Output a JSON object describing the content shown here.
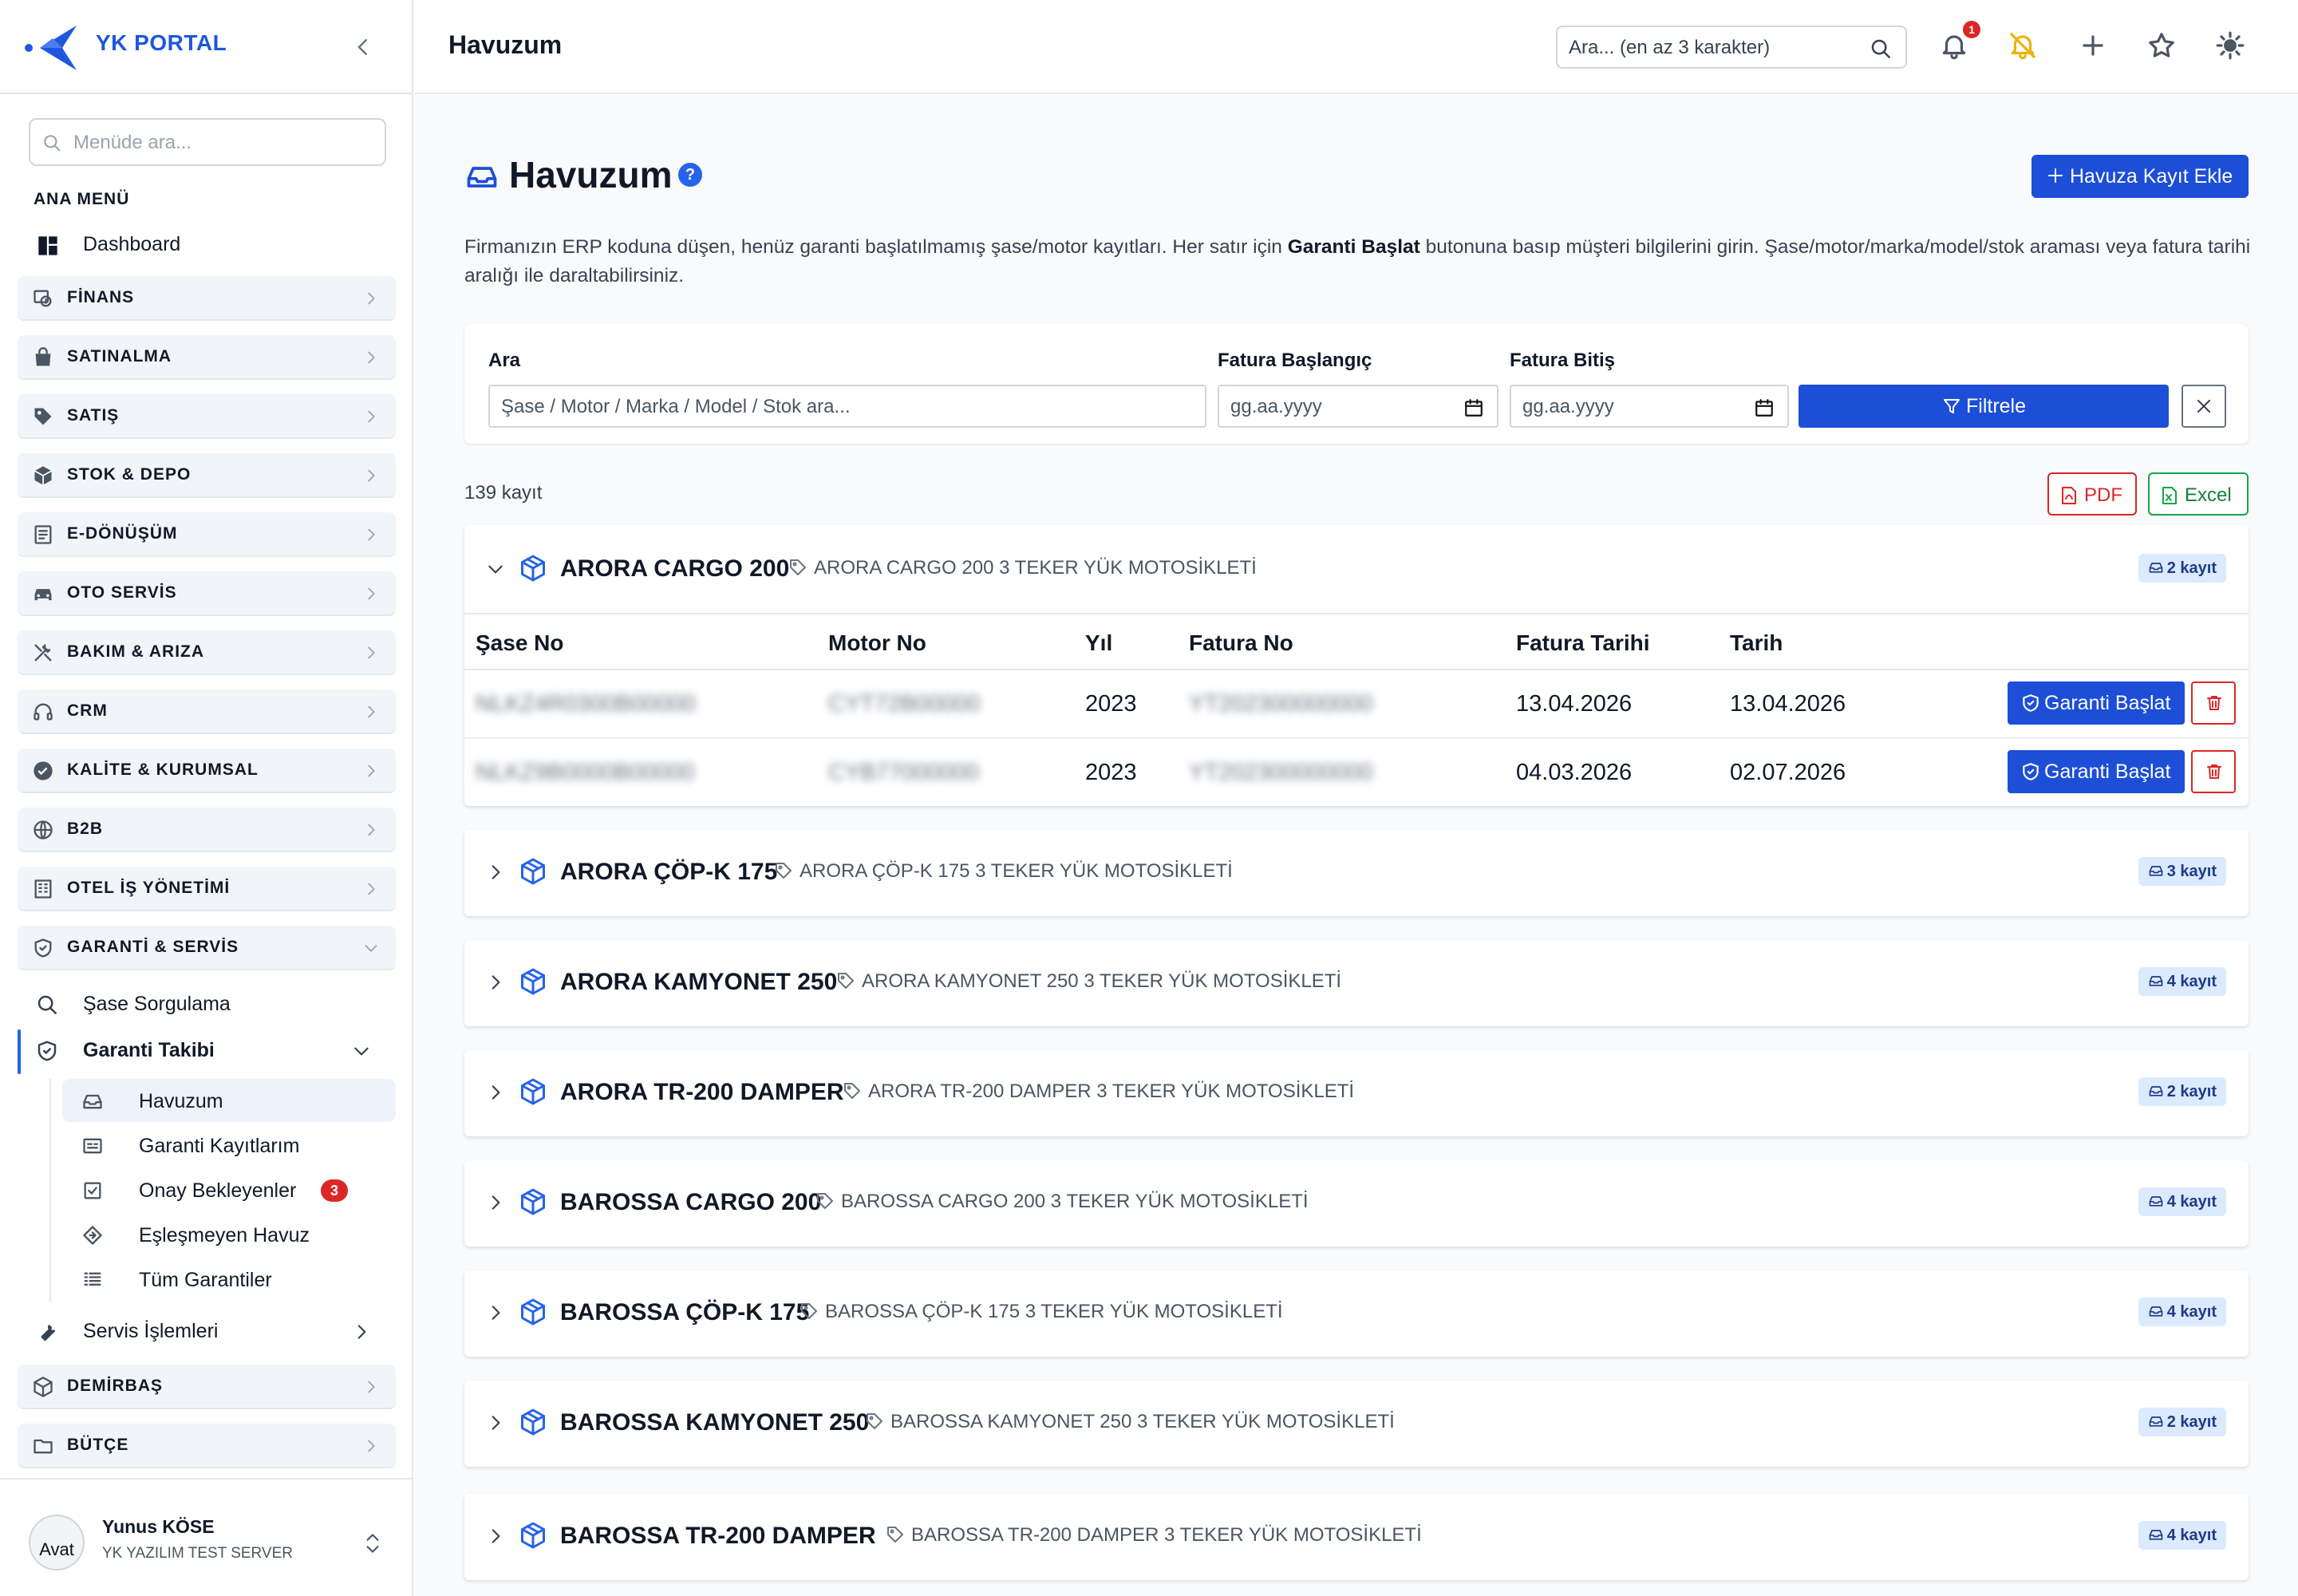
{
  "brand": {
    "name": "YK PORTAL"
  },
  "sidebar": {
    "search_placeholder": "Menüde ara...",
    "section_title": "ANA MENÜ",
    "dashboard": "Dashboard",
    "groups_top": [
      {
        "label": "FİNANS",
        "icon": "finance-icon"
      },
      {
        "label": "SATINALMA",
        "icon": "bag-icon"
      },
      {
        "label": "SATIŞ",
        "icon": "tag-icon"
      },
      {
        "label": "STOK & DEPO",
        "icon": "box-icon"
      },
      {
        "label": "E-DÖNÜŞÜM",
        "icon": "document-icon"
      },
      {
        "label": "OTO SERVİS",
        "icon": "car-icon"
      },
      {
        "label": "BAKIM & ARIZA",
        "icon": "tools-icon"
      },
      {
        "label": "CRM",
        "icon": "headset-icon"
      },
      {
        "label": "KALİTE & KURUMSAL",
        "icon": "badge-check-icon"
      },
      {
        "label": "B2B",
        "icon": "globe-icon"
      },
      {
        "label": "OTEL İŞ YÖNETİMİ",
        "icon": "building-icon"
      },
      {
        "label": "GARANTİ & SERVİS",
        "icon": "shield-icon"
      }
    ],
    "sase_sorgulama": "Şase Sorgulama",
    "garanti_takibi": "Garanti Takibi",
    "garanti_sub": [
      {
        "label": "Havuzum",
        "icon": "inbox-icon"
      },
      {
        "label": "Garanti Kayıtlarım",
        "icon": "card-icon"
      },
      {
        "label": "Onay Bekleyenler",
        "icon": "check-square-icon",
        "badge": "3"
      },
      {
        "label": "Eşleşmeyen Havuz",
        "icon": "diamond-icon"
      },
      {
        "label": "Tüm Garantiler",
        "icon": "list-icon"
      }
    ],
    "servis_islemleri": "Servis İşlemleri",
    "groups_bottom": [
      {
        "label": "DEMİRBAŞ",
        "icon": "cube-icon"
      },
      {
        "label": "BÜTÇE",
        "icon": "folder-icon"
      }
    ],
    "user": {
      "avatar_text": "Avat",
      "name": "Yunus KÖSE",
      "company": "YK YAZILIM TEST SERVER"
    }
  },
  "topbar": {
    "title": "Havuzum",
    "search_placeholder": "Ara... (en az 3 karakter)",
    "notification_count": "1"
  },
  "main": {
    "title": "Havuzum",
    "help": "?",
    "add_button": "Havuza Kayıt Ekle",
    "description_1": "Firmanızın ERP koduna düşen, henüz garanti başlatılmamış şase/motor kayıtları. Her satır için ",
    "description_bold": "Garanti Başlat",
    "description_2": " butonuna basıp müşteri bilgilerini girin. Şase/motor/marka/model/stok araması veya fatura tarihi aralığı ile daraltabilirsiniz.",
    "filters": {
      "search_label": "Ara",
      "search_placeholder": "Şase / Motor / Marka / Model / Stok ara...",
      "start_label": "Fatura Başlangıç",
      "end_label": "Fatura Bitiş",
      "date_placeholder": "gg.aa.yyyy",
      "filter_button": "Filtrele"
    },
    "record_count": "139 kayıt",
    "pdf_button": "PDF",
    "excel_button": "Excel",
    "table_headers": [
      "Şase No",
      "Motor No",
      "Yıl",
      "Fatura No",
      "Fatura Tarihi",
      "Tarih"
    ],
    "start_warranty": "Garanti Başlat",
    "groups": [
      {
        "name": "ARORA CARGO 200",
        "desc": "ARORA CARGO 200 3 TEKER YÜK MOTOSİKLETİ",
        "count": "2 kayıt",
        "expanded": true,
        "rows": [
          {
            "sase": "NLKZ4R0300B00000",
            "motor": "CYT72B00000",
            "yil": "2023",
            "fatura_no": "YT202300000000",
            "fatura_tarihi": "13.04.2026",
            "tarih": "13.04.2026"
          },
          {
            "sase": "NLKZ9B0000B00000",
            "motor": "CYB77000000",
            "yil": "2023",
            "fatura_no": "YT202300000000",
            "fatura_tarihi": "04.03.2026",
            "tarih": "02.07.2026"
          }
        ]
      },
      {
        "name": "ARORA ÇÖP-K 175",
        "desc": "ARORA ÇÖP-K 175 3 TEKER YÜK MOTOSİKLETİ",
        "count": "3 kayıt"
      },
      {
        "name": "ARORA KAMYONET 250",
        "desc": "ARORA KAMYONET 250 3 TEKER YÜK MOTOSİKLETİ",
        "count": "4 kayıt"
      },
      {
        "name": "ARORA TR-200 DAMPER",
        "desc": "ARORA TR-200 DAMPER 3 TEKER YÜK MOTOSİKLETİ",
        "count": "2 kayıt"
      },
      {
        "name": "BAROSSA CARGO 200",
        "desc": "BAROSSA CARGO 200 3 TEKER YÜK MOTOSİKLETİ",
        "count": "4 kayıt"
      },
      {
        "name": "BAROSSA ÇÖP-K 175",
        "desc": "BAROSSA ÇÖP-K 175 3 TEKER YÜK MOTOSİKLETİ",
        "count": "4 kayıt"
      },
      {
        "name": "BAROSSA KAMYONET 250",
        "desc": "BAROSSA KAMYONET 250 3 TEKER YÜK MOTOSİKLETİ",
        "count": "2 kayıt"
      },
      {
        "name": "BAROSSA TR-200 DAMPER",
        "desc": "BAROSSA TR-200 DAMPER 3 TEKER YÜK MOTOSİKLETİ",
        "count": "4 kayıt"
      }
    ]
  }
}
